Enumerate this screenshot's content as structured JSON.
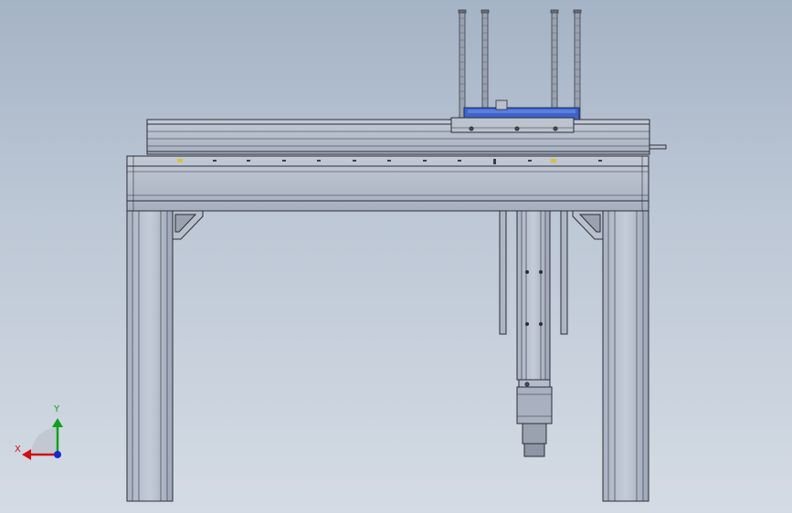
{
  "viewport": {
    "background_top": "#a5b3c6",
    "background_bottom": "#d4dbe4"
  },
  "model": {
    "frame_color": "#b4bccb",
    "edge_color": "#2a2e36",
    "carriage_color": "#3f63c8"
  },
  "triad": {
    "x_label": "X",
    "y_label": "Y",
    "x_color": "#d01010",
    "y_color": "#10a020",
    "z_color": "#1828d0"
  }
}
